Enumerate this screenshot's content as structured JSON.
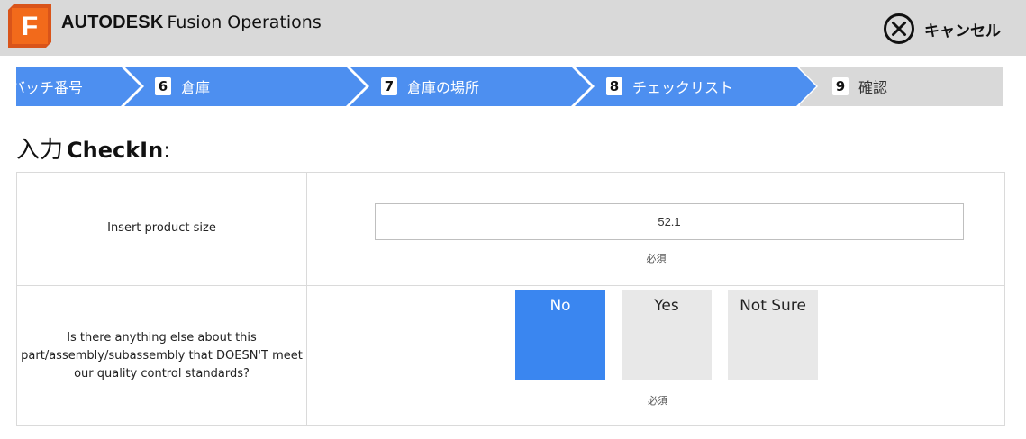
{
  "header": {
    "logo_letter": "F",
    "brand_primary": "AUTODESK",
    "brand_secondary": "Fusion Operations",
    "cancel_label": "キャンセル"
  },
  "steps": [
    {
      "number": "",
      "label": "バッチ番号",
      "state": "active"
    },
    {
      "number": "6",
      "label": "倉庫",
      "state": "active"
    },
    {
      "number": "7",
      "label": "倉庫の場所",
      "state": "active"
    },
    {
      "number": "8",
      "label": "チェックリスト",
      "state": "active"
    },
    {
      "number": "9",
      "label": "確認",
      "state": "inactive"
    }
  ],
  "title": {
    "prefix": "入力",
    "name": "CheckIn",
    "suffix": ":"
  },
  "form": {
    "size": {
      "label": "Insert product size",
      "value": "52.1",
      "required": "必須"
    },
    "quality": {
      "label": "Is there anything else about this part/assembly/subassembly that DOESN'T meet our quality control standards?",
      "options": [
        "No",
        "Yes",
        "Not Sure"
      ],
      "selected": "No",
      "required": "必須"
    }
  },
  "colors": {
    "accent": "#3a86f0",
    "step_active": "#4d8ff0",
    "step_inactive": "#d9d9d9",
    "header_bg": "#d9d9d9",
    "logo_orange": "#f26a1b"
  }
}
